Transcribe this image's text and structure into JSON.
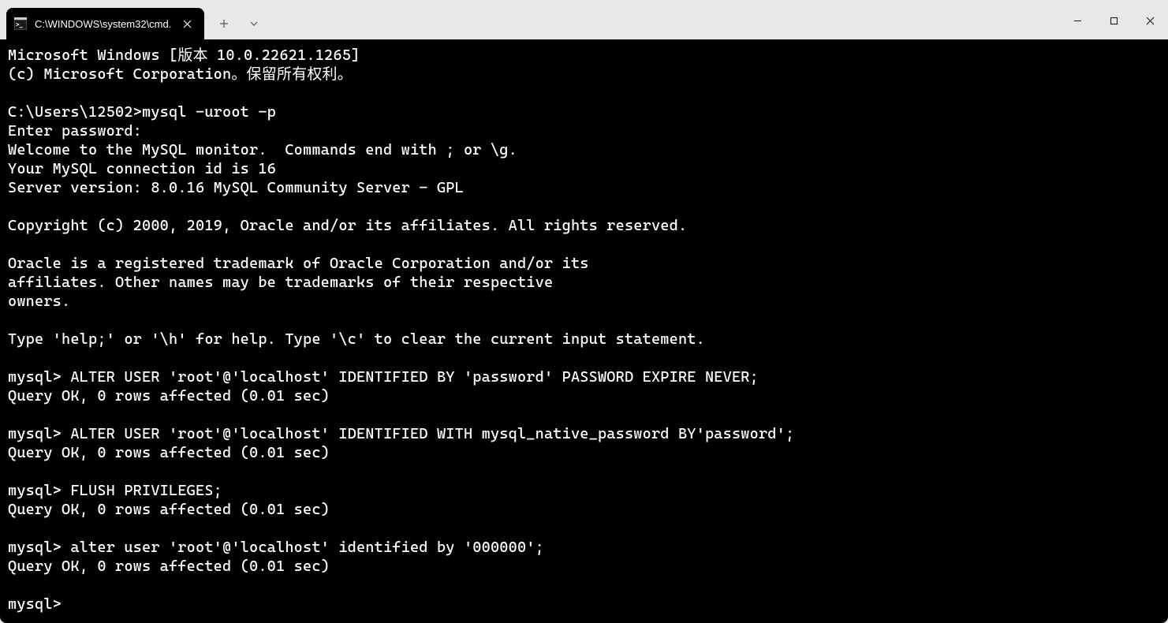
{
  "tab": {
    "title": "C:\\WINDOWS\\system32\\cmd."
  },
  "terminal": {
    "lines": [
      "Microsoft Windows [版本 10.0.22621.1265]",
      "(c) Microsoft Corporation。保留所有权利。",
      "",
      "C:\\Users\\12502>mysql -uroot -p",
      "Enter password:",
      "Welcome to the MySQL monitor.  Commands end with ; or \\g.",
      "Your MySQL connection id is 16",
      "Server version: 8.0.16 MySQL Community Server - GPL",
      "",
      "Copyright (c) 2000, 2019, Oracle and/or its affiliates. All rights reserved.",
      "",
      "Oracle is a registered trademark of Oracle Corporation and/or its",
      "affiliates. Other names may be trademarks of their respective",
      "owners.",
      "",
      "Type 'help;' or '\\h' for help. Type '\\c' to clear the current input statement.",
      "",
      "mysql> ALTER USER 'root'@'localhost' IDENTIFIED BY 'password' PASSWORD EXPIRE NEVER;",
      "Query OK, 0 rows affected (0.01 sec)",
      "",
      "mysql> ALTER USER 'root'@'localhost' IDENTIFIED WITH mysql_native_password BY'password';",
      "Query OK, 0 rows affected (0.01 sec)",
      "",
      "mysql> FLUSH PRIVILEGES;",
      "Query OK, 0 rows affected (0.01 sec)",
      "",
      "mysql> alter user 'root'@'localhost' identified by '000000';",
      "Query OK, 0 rows affected (0.01 sec)",
      "",
      "mysql>"
    ]
  }
}
